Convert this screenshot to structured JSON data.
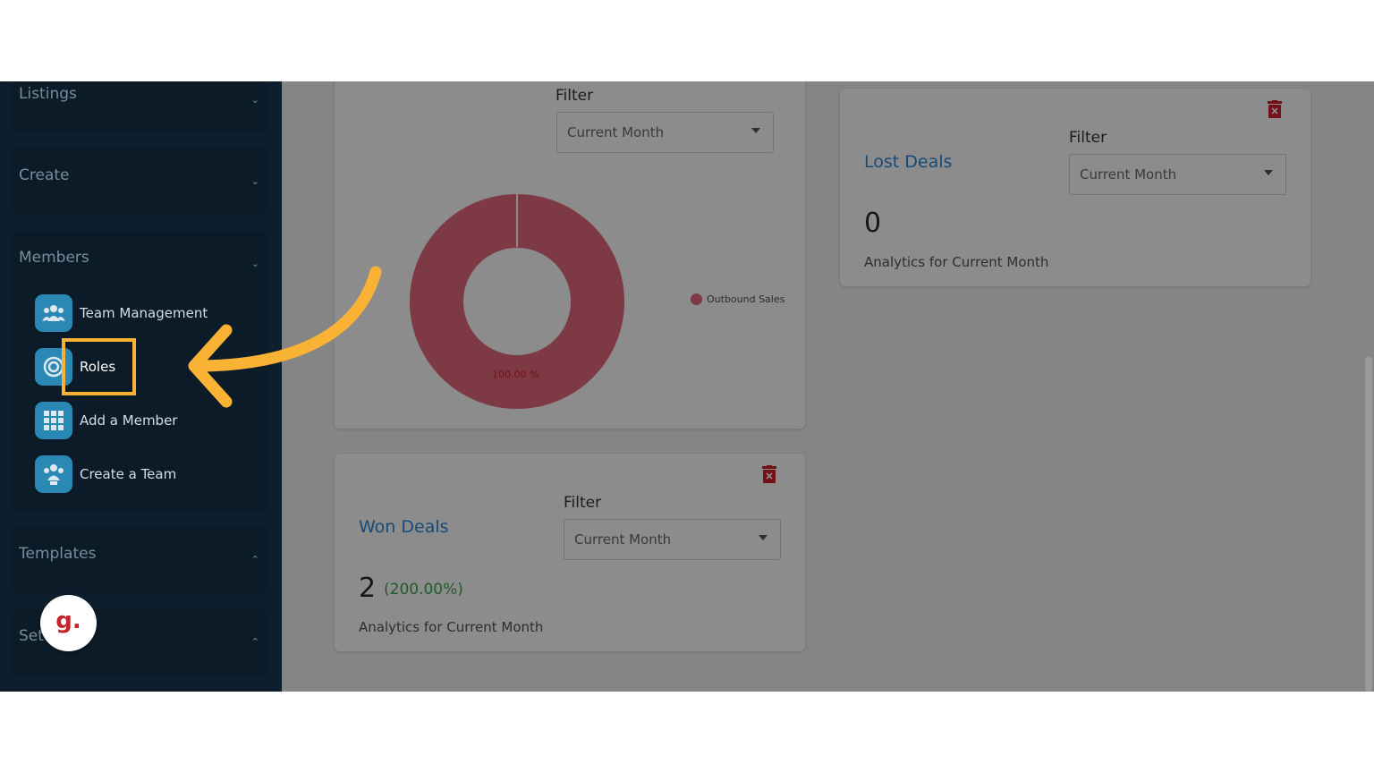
{
  "sidebar": {
    "sections": [
      {
        "label": "Listings",
        "chevron": "chevron-down"
      },
      {
        "label": "Create",
        "chevron": "chevron-down"
      },
      {
        "label": "Members",
        "chevron": "chevron-down"
      },
      {
        "label": "Templates",
        "chevron": "chevron-up"
      },
      {
        "label": "Set",
        "chevron": "chevron-up"
      }
    ],
    "member_items": [
      {
        "label": "Team Management",
        "icon": "team-icon"
      },
      {
        "label": "Roles",
        "icon": "target-icon"
      },
      {
        "label": "Add a Member",
        "icon": "grid-icon"
      },
      {
        "label": "Create a Team",
        "icon": "group-icon"
      }
    ],
    "chevron_down": "⌄",
    "chevron_up": "⌃"
  },
  "donut_card": {
    "filter_label": "Filter",
    "select_value": "Current Month",
    "legend_label": "Outbound Sales",
    "slice_label": "100.00 %",
    "slice_color": "#e36a7d"
  },
  "lost_deals": {
    "title": "Lost Deals",
    "filter_label": "Filter",
    "select_value": "Current Month",
    "count": "0",
    "subtitle": "Analytics for Current Month"
  },
  "won_deals": {
    "title": "Won Deals",
    "filter_label": "Filter",
    "select_value": "Current Month",
    "count": "2",
    "change": "(200.00%)",
    "subtitle": "Analytics for Current Month"
  },
  "overlay": {
    "badge_letter": "g.",
    "highlight_color": "#f9b233"
  },
  "colors": {
    "accent": "#2b88d8",
    "positive": "#3aa845",
    "danger": "#d0202a",
    "sidebar_bg": "#0d1f2d"
  }
}
